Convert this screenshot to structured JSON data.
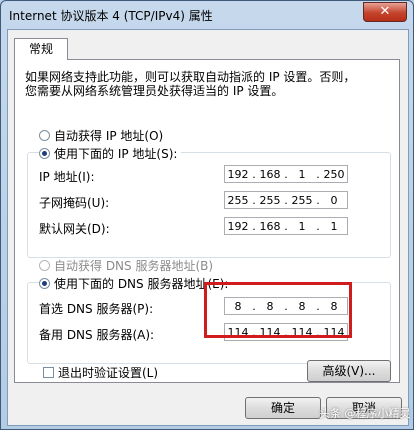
{
  "window": {
    "title": "Internet 协议版本 4 (TCP/IPv4) 属性",
    "close_label": "✕"
  },
  "tab": {
    "label": "常规"
  },
  "description": {
    "line1": "如果网络支持此功能，则可以获取自动指派的 IP 设置。否则，",
    "line2": "您需要从网络系统管理员处获得适当的 IP 设置。"
  },
  "ip_group": {
    "auto_label": "自动获得 IP 地址(O)",
    "manual_label": "使用下面的 IP 地址(S):",
    "ip_label": "IP 地址(I):",
    "ip_value": [
      "192",
      "168",
      "1",
      "250"
    ],
    "mask_label": "子网掩码(U):",
    "mask_value": [
      "255",
      "255",
      "255",
      "0"
    ],
    "gateway_label": "默认网关(D):",
    "gateway_value": [
      "192",
      "168",
      "1",
      "1"
    ]
  },
  "dns_group": {
    "auto_label": "自动获得 DNS 服务器地址(B)",
    "manual_label": "使用下面的 DNS 服务器地址(E):",
    "preferred_label": "首选 DNS 服务器(P):",
    "preferred_value": [
      "8",
      "8",
      "8",
      "8"
    ],
    "alternate_label": "备用 DNS 服务器(A):",
    "alternate_value": [
      "114",
      "114",
      "114",
      "114"
    ]
  },
  "validate_label": "退出时验证设置(L)",
  "advanced_label": "高级(V)...",
  "ok_label": "确定",
  "cancel_label": "取消",
  "watermark": "头条 @程序小精灵",
  "colors": {
    "highlight": "#d01c1c"
  }
}
